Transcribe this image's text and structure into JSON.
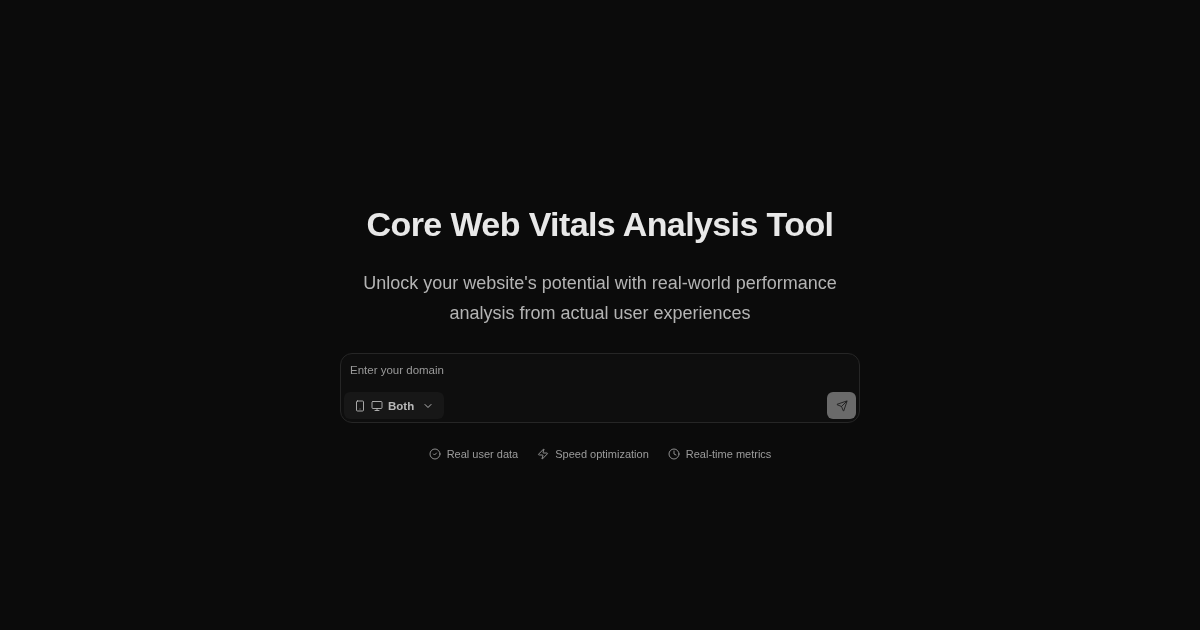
{
  "hero": {
    "title": "Core Web Vitals Analysis Tool",
    "subtitle": "Unlock your website's potential with real-world performance analysis from actual user experiences"
  },
  "domain_form": {
    "placeholder": "Enter your domain",
    "device_select": {
      "value": "Both"
    },
    "submit": {
      "disabled": true
    }
  },
  "features": [
    {
      "kind": "check",
      "label": "Real user data"
    },
    {
      "kind": "bolt",
      "label": "Speed optimization"
    },
    {
      "kind": "clock",
      "label": "Real-time metrics"
    }
  ]
}
